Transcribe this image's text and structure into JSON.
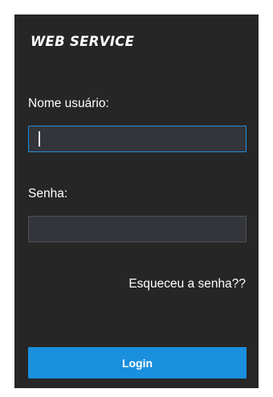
{
  "header": {
    "title": "WEB SERVICE"
  },
  "form": {
    "username_label": "Nome usuário:",
    "username_value": "",
    "password_label": "Senha:",
    "password_value": "",
    "forgot_link": "Esqueceu a senha??",
    "login_button": "Login"
  },
  "colors": {
    "panel_background": "#262626",
    "input_background": "#33353a",
    "focus_border": "#1e8fe0",
    "accent": "#1a8fde",
    "text": "#ffffff"
  }
}
